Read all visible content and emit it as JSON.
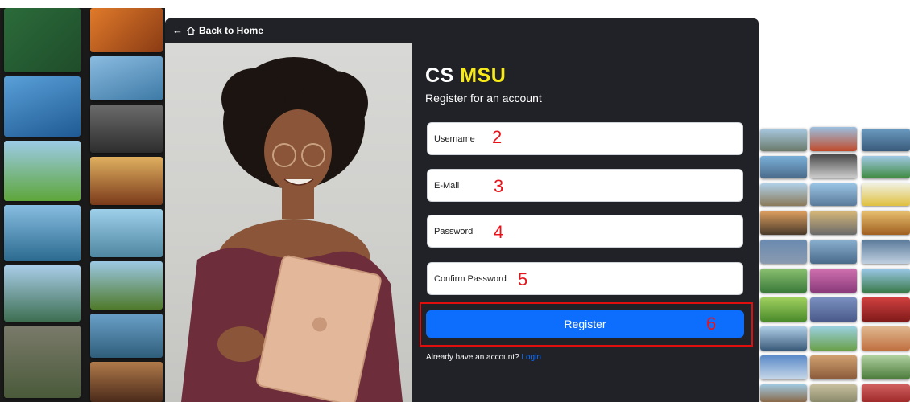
{
  "header": {
    "back_label": "Back to Home",
    "back_arrow": "←"
  },
  "brand": {
    "part1": "CS",
    "part2": "MSU"
  },
  "subtitle": "Register for an account",
  "form": {
    "username": {
      "placeholder": "Username",
      "step": "2"
    },
    "email": {
      "placeholder": "E-Mail",
      "step": "3"
    },
    "password": {
      "placeholder": "Password",
      "step": "4"
    },
    "confirm": {
      "placeholder": "Confirm Password",
      "step": "5"
    },
    "register": {
      "label": "Register",
      "step": "6"
    }
  },
  "footer": {
    "prompt": "Already have an account?",
    "login_label": "Login"
  },
  "colors": {
    "modal_bg": "#202227",
    "brand_accent": "#f8ea16",
    "button_primary": "#0d6efd",
    "annotation_red": "#e8131a"
  }
}
